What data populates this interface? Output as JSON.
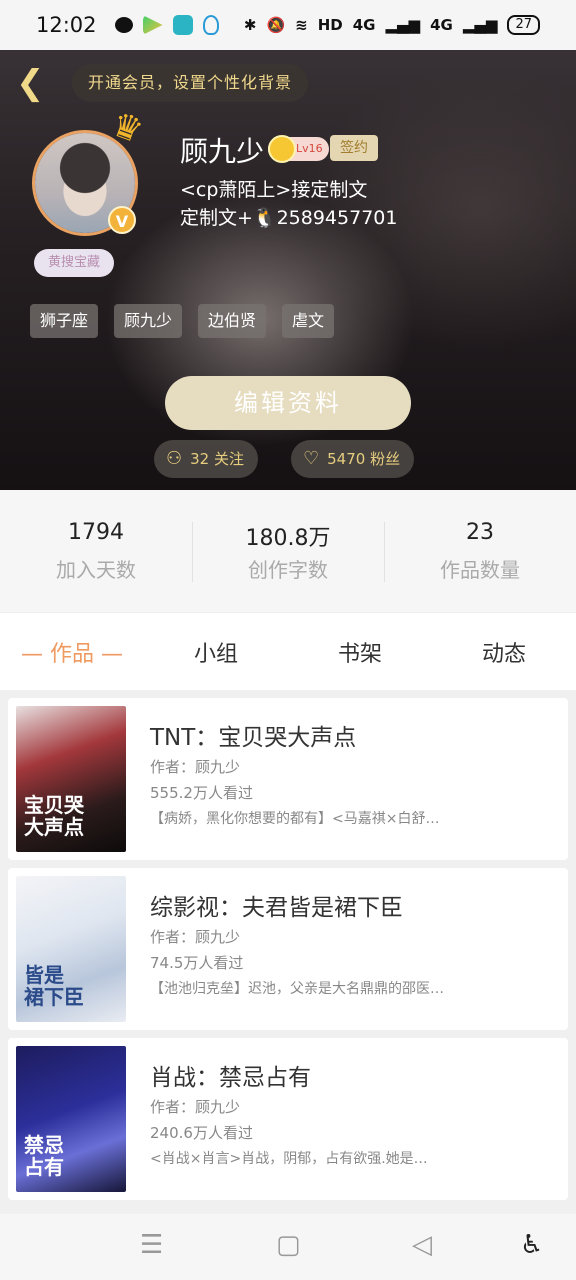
{
  "status_bar": {
    "time": "12:02",
    "network": "HD",
    "signal_1": "4G",
    "signal_2": "4G",
    "battery": "27"
  },
  "header": {
    "back_icon": "back-icon",
    "vip_banner": "开通会员，设置个性化背景",
    "username": "顾九少",
    "level": "Lv16",
    "sign_label": "签约",
    "bio_line1": "<cp萧陌上>接定制文",
    "bio_line2": "定制文+🐧2589457701",
    "badge": "黄搜宝藏",
    "verified_mark": "V",
    "tags": [
      "狮子座",
      "顾九少",
      "边伯贤",
      "虐文"
    ],
    "edit_button": "编辑资料",
    "following": "32 关注",
    "fans": "5470 粉丝"
  },
  "stats": [
    {
      "value": "1794",
      "label": "加入天数"
    },
    {
      "value": "180.8万",
      "label": "创作字数"
    },
    {
      "value": "23",
      "label": "作品数量"
    }
  ],
  "tabs": [
    {
      "label": "— 作品 —",
      "active": true
    },
    {
      "label": "小组",
      "active": false
    },
    {
      "label": "书架",
      "active": false
    },
    {
      "label": "动态",
      "active": false
    }
  ],
  "works": [
    {
      "title": "TNT：宝贝哭大声点",
      "author": "作者：顾九少",
      "views": "555.2万人看过",
      "desc": "【病娇，黑化你想要的都有】<马嘉祺×白舒…",
      "cover_text": "宝贝哭\n大声点"
    },
    {
      "title": "综影视：夫君皆是裙下臣",
      "author": "作者：顾九少",
      "views": "74.5万人看过",
      "desc": "【池池归克垒】迟池，父亲是大名鼎鼎的邵医…",
      "cover_text": "皆是\n裙下臣"
    },
    {
      "title": "肖战：禁忌占有",
      "author": "作者：顾九少",
      "views": "240.6万人看过",
      "desc": "<肖战×肖言>肖战，阴郁，占有欲强.她是…",
      "cover_text": "禁忌\n占有"
    }
  ],
  "colors": {
    "accent": "#ef9a61",
    "gold": "#e7cd7f",
    "edit_button_bg": "#e6dcc0"
  }
}
